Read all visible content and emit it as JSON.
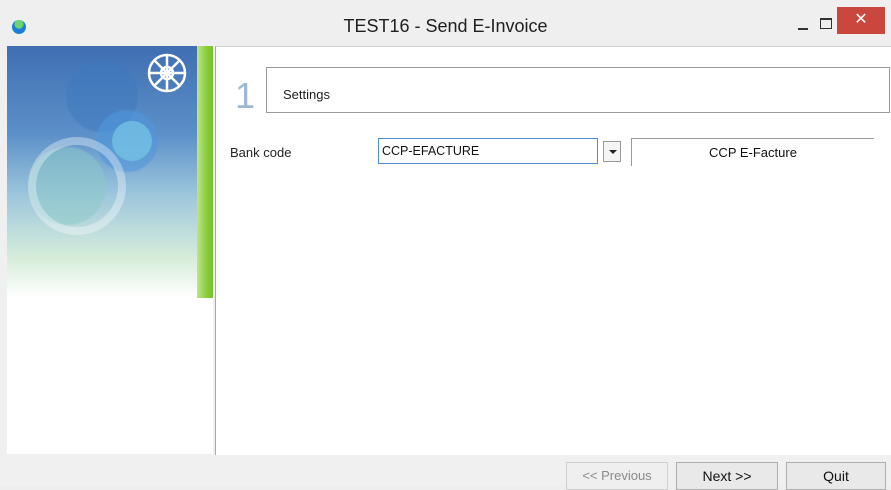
{
  "window": {
    "title": "TEST16 - Send E-Invoice",
    "close_glyph": "✕"
  },
  "step": {
    "number": "1",
    "label": "Settings"
  },
  "form": {
    "bank_code_label": "Bank code",
    "bank_code_value": "CCP-EFACTURE",
    "bank_code_description": "CCP E-Facture"
  },
  "buttons": {
    "previous": "<< Previous",
    "next": "Next  >>",
    "quit": "Quit"
  },
  "colors": {
    "close_button": "#c9473d",
    "input_focus_border": "#4a8fd8",
    "step_number": "#9bb9d4"
  },
  "icons": {
    "app": "app-icon",
    "dropdown": "chevron-down-icon",
    "minimize": "minimize-icon",
    "maximize": "maximize-icon",
    "close": "close-icon"
  }
}
